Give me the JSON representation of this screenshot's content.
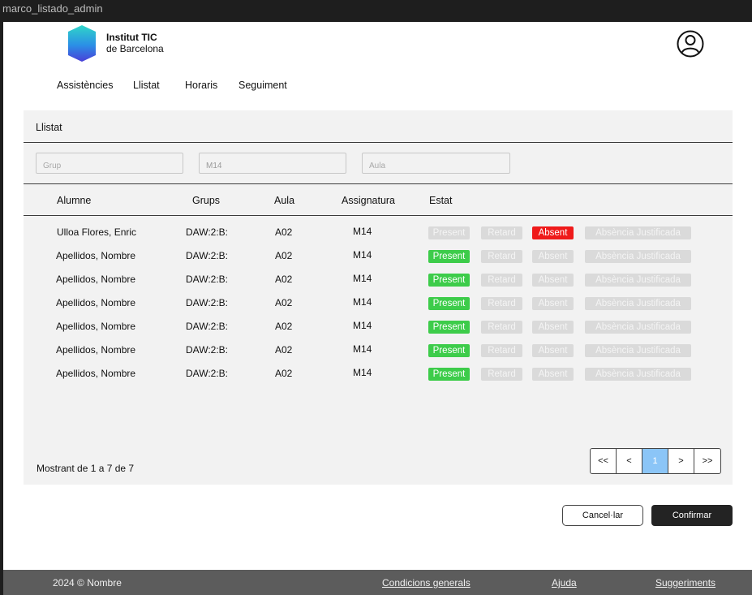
{
  "window": {
    "title": "marco_listado_admin"
  },
  "header": {
    "brand_line1": "Institut TIC",
    "brand_line2": "de Barcelona"
  },
  "nav": [
    "Assistències",
    "Llistat",
    "Horaris",
    "Seguiment"
  ],
  "panel": {
    "title": "Llistat",
    "filters": {
      "grup_placeholder": "Grup",
      "assignatura_value": "M14",
      "aula_placeholder": "Aula"
    },
    "columns": [
      "Alumne",
      "Grups",
      "Aula",
      "Assignatura",
      "Estat"
    ],
    "status_labels": [
      "Present",
      "Retard",
      "Absent",
      "Absència Justificada"
    ],
    "rows": [
      {
        "alumne": "Ulloa Flores, Enric",
        "grups": "DAW:2:B:",
        "aula": "A02",
        "assignatura": "M14",
        "estat": "Absent"
      },
      {
        "alumne": "Apellidos, Nombre",
        "grups": "DAW:2:B:",
        "aula": "A02",
        "assignatura": "M14",
        "estat": "Present"
      },
      {
        "alumne": "Apellidos, Nombre",
        "grups": "DAW:2:B:",
        "aula": "A02",
        "assignatura": "M14",
        "estat": "Present"
      },
      {
        "alumne": "Apellidos, Nombre",
        "grups": "DAW:2:B:",
        "aula": "A02",
        "assignatura": "M14",
        "estat": "Present"
      },
      {
        "alumne": "Apellidos, Nombre",
        "grups": "DAW:2:B:",
        "aula": "A02",
        "assignatura": "M14",
        "estat": "Present"
      },
      {
        "alumne": "Apellidos, Nombre",
        "grups": "DAW:2:B:",
        "aula": "A02",
        "assignatura": "M14",
        "estat": "Present"
      },
      {
        "alumne": "Apellidos, Nombre",
        "grups": "DAW:2:B:",
        "aula": "A02",
        "assignatura": "M14",
        "estat": "Present"
      }
    ],
    "summary": "Mostrant de 1 a 7 de 7",
    "pagination": {
      "first": "<<",
      "prev": "<",
      "current": "1",
      "next": ">",
      "last": ">>"
    }
  },
  "actions": {
    "cancel": "Cancel·lar",
    "confirm": "Confirmar"
  },
  "footer": {
    "copyright": "2024 © Nombre",
    "links": [
      "Condicions generals",
      "Ajuda",
      "Suggeriments"
    ]
  },
  "colors": {
    "present": "#3dcc4a",
    "absent": "#ef1a1a",
    "inactive": "#dadada",
    "active_page": "#8bc5f7",
    "footer": "#5c5c5c"
  },
  "icons": {
    "logo": "hexagon-logo-icon",
    "user": "user-circle-icon"
  }
}
